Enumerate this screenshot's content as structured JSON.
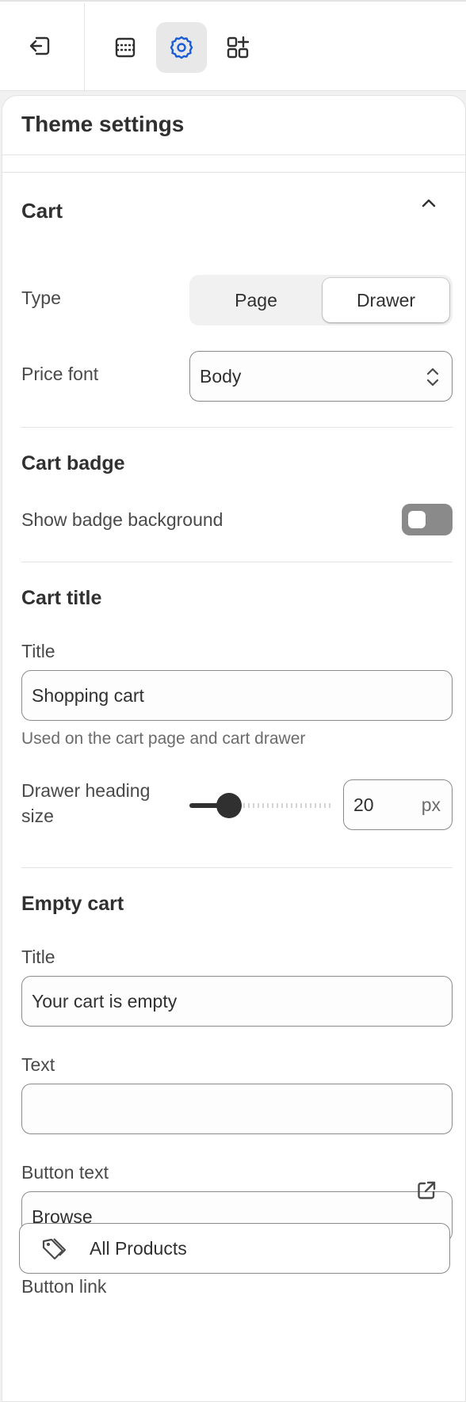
{
  "toolbar": {
    "exit_icon": "exit-icon",
    "sections_icon": "sections-icon",
    "settings_icon": "gear-icon",
    "apps_icon": "apps-add-icon",
    "accent": "#1a5bd6"
  },
  "panel": {
    "title": "Theme settings"
  },
  "cart": {
    "heading": "Cart",
    "type_label": "Type",
    "type_options": [
      "Page",
      "Drawer"
    ],
    "type_selected": "Drawer",
    "price_font_label": "Price font",
    "price_font_value": "Body"
  },
  "cart_badge": {
    "heading": "Cart badge",
    "show_bg_label": "Show badge background",
    "show_bg_on": false
  },
  "cart_title": {
    "heading": "Cart title",
    "title_label": "Title",
    "title_value": "Shopping cart",
    "help": "Used on the cart page and cart drawer",
    "drawer_heading_label_1": "Drawer heading",
    "drawer_heading_label_2": "size",
    "drawer_heading_size": "20",
    "unit": "px"
  },
  "empty_cart": {
    "heading": "Empty cart",
    "title_label": "Title",
    "title_value": "Your cart is empty",
    "text_label": "Text",
    "text_value": "",
    "button_text_label": "Button text",
    "button_text_value": "Browse",
    "button_link_label": "Button link",
    "button_link_value": "All Products"
  }
}
